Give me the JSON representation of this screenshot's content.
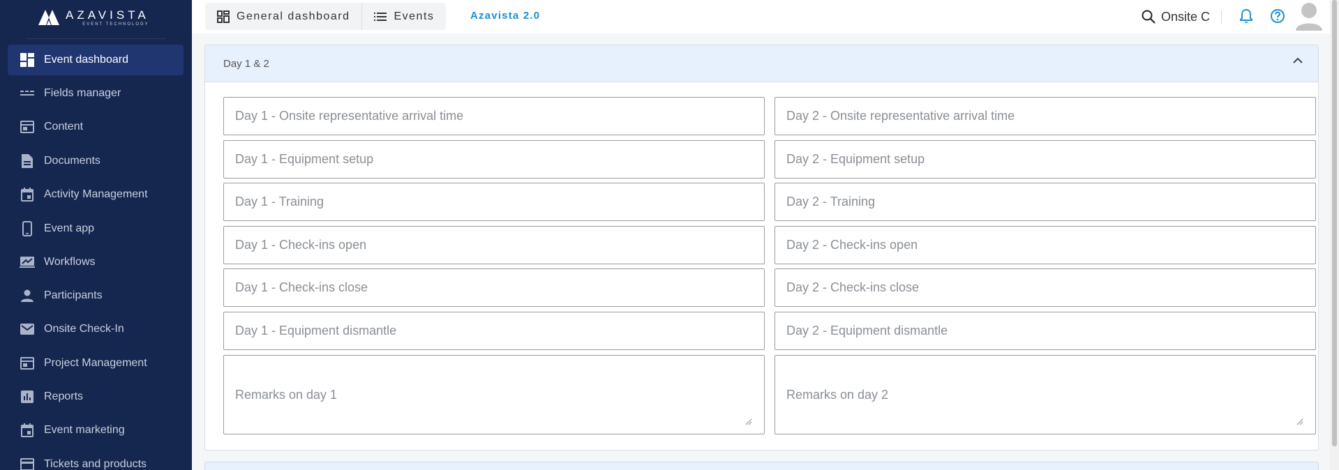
{
  "brand": {
    "name": "AZAVISTA",
    "tagline": "EVENT TECHNOLOGY"
  },
  "sidebar": {
    "items": [
      {
        "label": "Event dashboard",
        "icon": "dashboard-icon",
        "active": true
      },
      {
        "label": "Fields manager",
        "icon": "fields-icon",
        "active": false
      },
      {
        "label": "Content",
        "icon": "content-icon",
        "active": false
      },
      {
        "label": "Documents",
        "icon": "document-icon",
        "active": false
      },
      {
        "label": "Activity Management",
        "icon": "calendar-icon",
        "active": false
      },
      {
        "label": "Event app",
        "icon": "phone-icon",
        "active": false
      },
      {
        "label": "Workflows",
        "icon": "workflow-icon",
        "active": false
      },
      {
        "label": "Participants",
        "icon": "person-icon",
        "active": false
      },
      {
        "label": "Onsite Check-In",
        "icon": "mail-icon",
        "active": false
      },
      {
        "label": "Project Management",
        "icon": "project-icon",
        "active": false
      },
      {
        "label": "Reports",
        "icon": "reports-icon",
        "active": false
      },
      {
        "label": "Event marketing",
        "icon": "calendar-icon",
        "active": false
      },
      {
        "label": "Tickets and products",
        "icon": "ticket-icon",
        "active": false
      }
    ]
  },
  "topbar": {
    "tabs": [
      {
        "label": "General dashboard",
        "icon": "grid-icon"
      },
      {
        "label": "Events",
        "icon": "list-icon"
      }
    ],
    "version": "Azavista 2.0",
    "user_label": "Onsite C",
    "icons": [
      "search-icon",
      "bell-icon",
      "help-icon",
      "avatar-icon"
    ]
  },
  "panel": {
    "title": "Day 1 & 2",
    "day1": [
      "Day 1 - Onsite representative arrival time",
      "Day 1 - Equipment setup",
      "Day 1 - Training",
      "Day 1 - Check-ins open",
      "Day 1 - Check-ins close",
      "Day 1 - Equipment dismantle"
    ],
    "day2": [
      "Day 2 - Onsite representative arrival time",
      "Day 2 - Equipment setup",
      "Day 2 - Training",
      "Day 2 - Check-ins open",
      "Day 2 - Check-ins close",
      "Day 2 - Equipment dismantle"
    ],
    "remarks": [
      "Remarks on day 1",
      "Remarks on day 2"
    ]
  },
  "colors": {
    "sidebar_bg": "#15264f",
    "sidebar_active": "#1f3670",
    "accent": "#1a8fd6",
    "panel_header": "#e7f0fd"
  }
}
